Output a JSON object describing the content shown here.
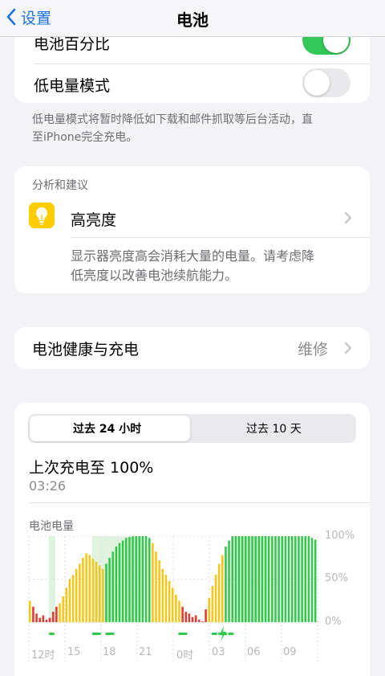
{
  "nav": {
    "back_label": "设置",
    "title": "电池"
  },
  "settings": {
    "battery_percentage_label": "电池百分比",
    "battery_percentage_on": true,
    "low_power_label": "低电量模式",
    "low_power_on": false,
    "low_power_footnote_1": "低电量模式将暂时降低如下载和邮件抓取等后台活动，直",
    "low_power_footnote_2": "至iPhone完全充电。"
  },
  "insights": {
    "header": "分析和建议",
    "item_title": "高亮度",
    "item_desc_1": "显示器亮度高会消耗大量的电量。请考虑降",
    "item_desc_2": "低亮度以改善电池续航能力。"
  },
  "health": {
    "label": "电池健康与充电",
    "value": "维修"
  },
  "usage": {
    "tabs": [
      "过去 24 小时",
      "过去 10 天"
    ],
    "selected_tab": 0,
    "last_charge_title": "上次充电至 100%",
    "last_charge_time": "03:26"
  },
  "colors": {
    "accent": "#1a73e8",
    "toggle_on": "#34c759",
    "toggle_off": "#e9e9eb",
    "bulb_bg": "#ffcc00"
  },
  "chart_data": {
    "type": "bar",
    "title": "电池电量",
    "y_ticks": [
      "100%",
      "50%",
      "0%"
    ],
    "x_ticks": [
      "12时",
      "15",
      "18",
      "21",
      "0时",
      "03",
      "06",
      "09"
    ],
    "ylim": [
      0,
      100
    ],
    "values": [
      25,
      18,
      10,
      5,
      8,
      3,
      5,
      12,
      18,
      22,
      30,
      40,
      50,
      55,
      62,
      68,
      75,
      80,
      78,
      74,
      70,
      66,
      62,
      68,
      75,
      82,
      88,
      92,
      95,
      98,
      99,
      100,
      100,
      100,
      100,
      100,
      98,
      92,
      82,
      72,
      62,
      55,
      48,
      40,
      32,
      25,
      18,
      12,
      10,
      6,
      8,
      3,
      0,
      15,
      28,
      42,
      55,
      68,
      78,
      88,
      95,
      100,
      100,
      100,
      100,
      100,
      100,
      100,
      100,
      100,
      100,
      100,
      100,
      100,
      100,
      100,
      100,
      100,
      100,
      100,
      100,
      100,
      100,
      100,
      100,
      98,
      96
    ]
  }
}
